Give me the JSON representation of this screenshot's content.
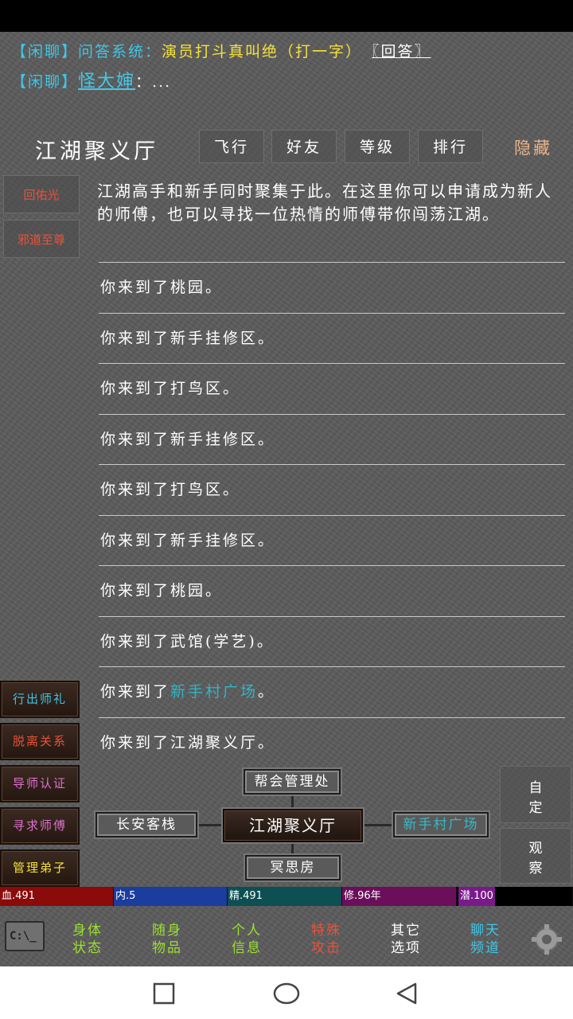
{
  "chat": {
    "line1": {
      "tag": "【闲聊】",
      "system": "问答系统：",
      "question": "演员打斗真叫绝（打一字）",
      "answer": "〖回答〗"
    },
    "line2": {
      "tag": "【闲聊】",
      "name": "怪大婶",
      "colon": "：",
      "text": "..."
    }
  },
  "header": {
    "title": "江湖聚义厅",
    "tabs": [
      "飞行",
      "好友",
      "等级",
      "排行"
    ],
    "hide": "隐藏"
  },
  "left_buttons": [
    "回佑光",
    "邪道至尊"
  ],
  "intro": "江湖高手和新手同时聚集于此。在这里你可以申请成为新人的师傅，也可以寻找一位热情的师傅带你闯荡江湖。",
  "log": [
    {
      "prefix": "你来到了",
      "place": "桃园",
      "suffix": "。"
    },
    {
      "prefix": "你来到了",
      "place": "新手挂修区",
      "suffix": "。"
    },
    {
      "prefix": "你来到了",
      "place": "打鸟区",
      "suffix": "。"
    },
    {
      "prefix": "你来到了",
      "place": "新手挂修区",
      "suffix": "。"
    },
    {
      "prefix": "你来到了",
      "place": "打鸟区",
      "suffix": "。"
    },
    {
      "prefix": "你来到了",
      "place": "新手挂修区",
      "suffix": "。"
    },
    {
      "prefix": "你来到了",
      "place": "桃园",
      "suffix": "。"
    },
    {
      "prefix": "你来到了",
      "place": "武馆(学艺)",
      "suffix": "。"
    },
    {
      "prefix": "你来到了",
      "place": "新手村广场",
      "suffix": "。"
    },
    {
      "prefix": "你来到了",
      "place": "江湖聚义厅",
      "suffix": "。"
    }
  ],
  "actions": [
    {
      "label": "行出师礼",
      "color": "#3fc6e6"
    },
    {
      "label": "脱离关系",
      "color": "#e6533c"
    },
    {
      "label": "导师认证",
      "color": "#e070d0"
    },
    {
      "label": "寻求师傅",
      "color": "#e070d0"
    },
    {
      "label": "管理弟子",
      "color": "#f5e23a"
    }
  ],
  "map": {
    "north": "帮会管理处",
    "west": "长安客栈",
    "current": "江湖聚义厅",
    "east": "新手村广场",
    "south": "冥思房"
  },
  "right_buttons": {
    "custom": [
      "自",
      "定"
    ],
    "observe": [
      "观",
      "察"
    ]
  },
  "stats": [
    {
      "label": "血.491",
      "color": "#8b0a0a"
    },
    {
      "label": "内.5",
      "color": "#1a3d9e"
    },
    {
      "label": "精.491",
      "color": "#0d4f52"
    },
    {
      "label": "修.96年",
      "color": "#6b0f5a"
    },
    {
      "label": "潜.100",
      "color": "#7a1a8a"
    }
  ],
  "bottom_nav": [
    {
      "line1": "身体",
      "line2": "状态",
      "color": "#9be02e"
    },
    {
      "line1": "随身",
      "line2": "物品",
      "color": "#9be02e"
    },
    {
      "line1": "个人",
      "line2": "信息",
      "color": "#9be02e"
    },
    {
      "line1": "特殊",
      "line2": "攻击",
      "color": "#e6533c"
    },
    {
      "line1": "其它",
      "line2": "选项",
      "color": "#ffffff"
    },
    {
      "line1": "聊天",
      "line2": "频道",
      "color": "#3fc6e6"
    }
  ],
  "cmd_icon": "C:\\_"
}
